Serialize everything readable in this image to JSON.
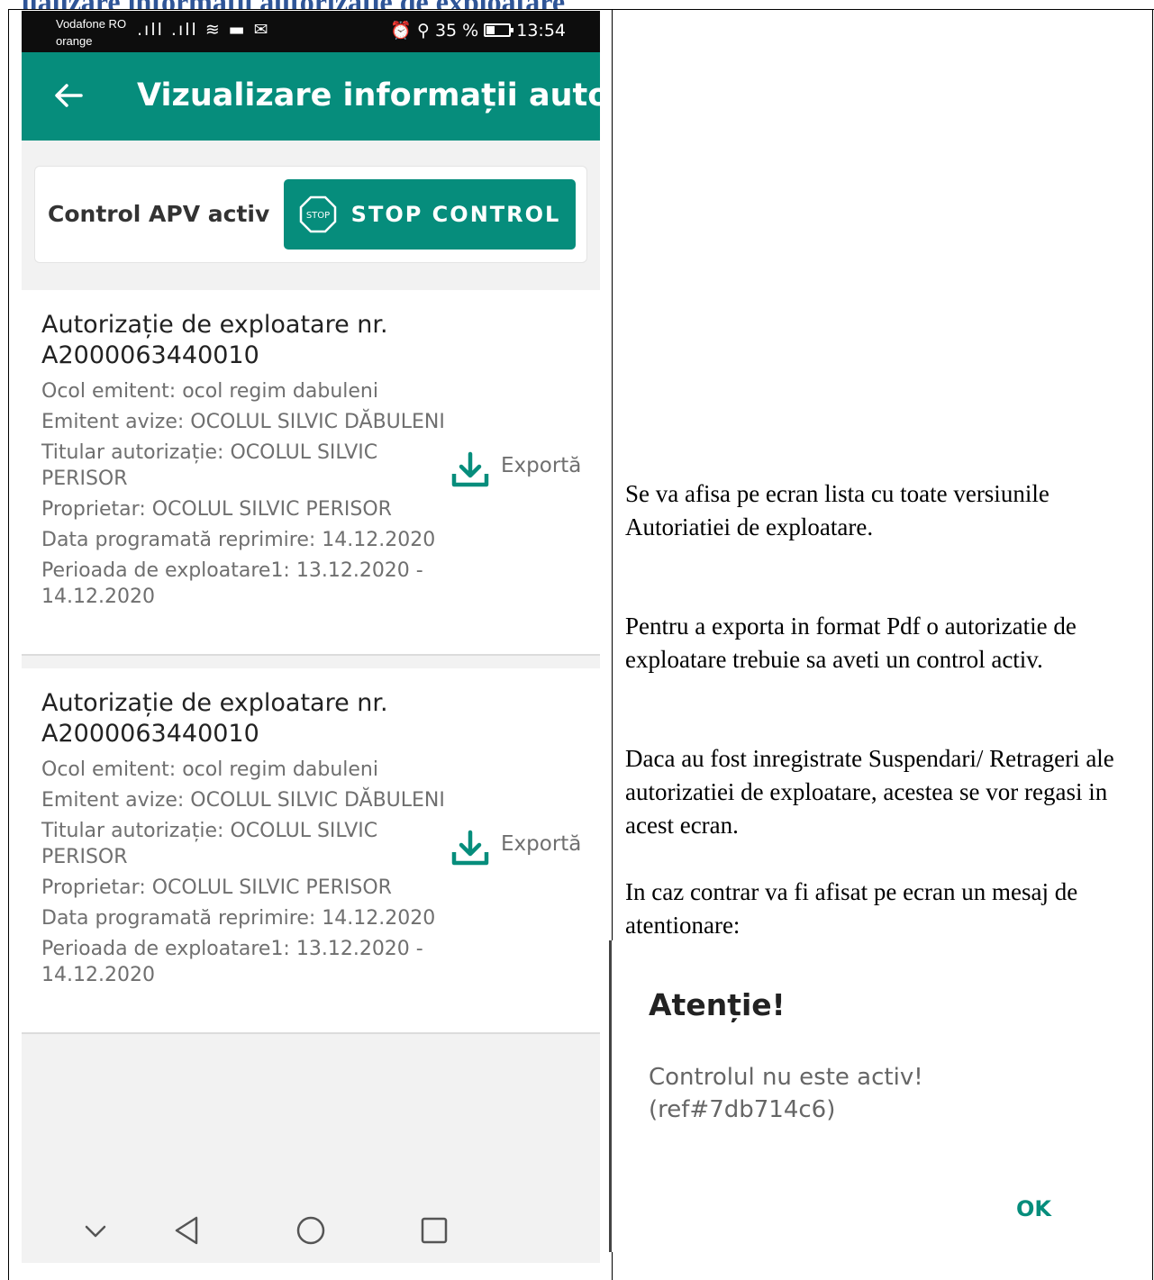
{
  "document": {
    "heading_fragment": "ualizare informatii autorizatie de exploatare",
    "heading_color": "#2f5597"
  },
  "status_bar": {
    "carrier_1": "Vodafone RO",
    "carrier_2": "orange",
    "left_icons": ".ıll .ıll ≋ ▬ ✉",
    "alarm_icon": "⏰",
    "location_icon": "⚲",
    "battery": "35 %",
    "time": "13:54"
  },
  "app_bar": {
    "title": "Vizualizare informații autor…",
    "color": "#068d7c"
  },
  "control": {
    "label": "Control APV activ",
    "stop_button": "STOP CONTROL",
    "stop_icon_text": "STOP"
  },
  "authorizations": [
    {
      "title": "Autorizație de exploatare nr. A2000063440010",
      "fields": [
        "Ocol emitent: ocol regim dabuleni",
        "Emitent avize: OCOLUL SILVIC DĂBULENI",
        "Titular autorizație: OCOLUL SILVIC PERISOR",
        "Proprietar: OCOLUL SILVIC PERISOR",
        "Data programată reprimire: 14.12.2020",
        "Perioada de exploatare1: 13.12.2020 - 14.12.2020"
      ],
      "export_label": "Exportă"
    },
    {
      "title": "Autorizație de exploatare nr. A2000063440010",
      "fields": [
        "Ocol emitent: ocol regim dabuleni",
        "Emitent avize: OCOLUL SILVIC DĂBULENI",
        "Titular autorizație: OCOLUL SILVIC PERISOR",
        "Proprietar: OCOLUL SILVIC PERISOR",
        "Data programată reprimire: 14.12.2020",
        "Perioada de exploatare1: 13.12.2020 - 14.12.2020"
      ],
      "export_label": "Exportă"
    }
  ],
  "description": {
    "p1": "Se va afisa pe ecran lista cu  toate versiunile Autoriatiei de exploatare.",
    "p2": "Pentru a exporta in format Pdf o autorizatie de exploatare trebuie sa aveti un control activ.",
    "p3": "Daca au fost inregistrate Suspendari/ Retrageri ale autorizatiei de exploatare, acestea se vor regasi in acest ecran.",
    "p4": "In caz contrar va fi afisat pe ecran un mesaj de atentionare:"
  },
  "dialog": {
    "title": "Atenție!",
    "message": "Controlul nu este activ! (ref#7db714c6)",
    "ok": "OK"
  }
}
